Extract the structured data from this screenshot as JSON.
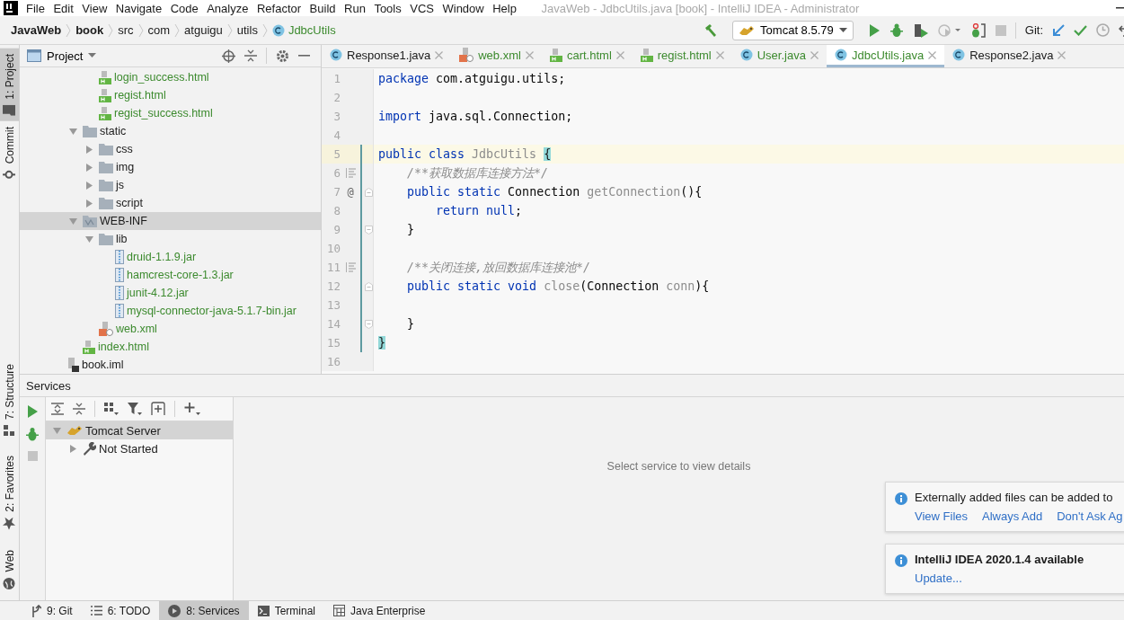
{
  "menu": {
    "items": [
      "File",
      "Edit",
      "View",
      "Navigate",
      "Code",
      "Analyze",
      "Refactor",
      "Build",
      "Run",
      "Tools",
      "VCS",
      "Window",
      "Help"
    ]
  },
  "title": "JavaWeb - JdbcUtils.java [book] - IntelliJ IDEA - Administrator",
  "breadcrumbs": [
    {
      "label": "JavaWeb",
      "kind": "module"
    },
    {
      "label": "book",
      "kind": "module"
    },
    {
      "label": "src",
      "kind": "dir"
    },
    {
      "label": "com",
      "kind": "dir"
    },
    {
      "label": "atguigu",
      "kind": "dir"
    },
    {
      "label": "utils",
      "kind": "dir"
    },
    {
      "label": "JdbcUtils",
      "kind": "class"
    }
  ],
  "toolbar": {
    "run_config": "Tomcat 8.5.79",
    "git_label": "Git:"
  },
  "left_stripe": {
    "top": [
      {
        "label": "1: Project",
        "kind": "folder",
        "selected": true
      },
      {
        "label": "Commit",
        "kind": "commit",
        "selected": false
      }
    ],
    "bottom": [
      {
        "label": "7: Structure",
        "kind": "structure",
        "selected": false
      },
      {
        "label": "2: Favorites",
        "kind": "star",
        "selected": false
      },
      {
        "label": "Web",
        "kind": "globe",
        "selected": false
      }
    ]
  },
  "project": {
    "title": "Project",
    "tree": [
      {
        "children": [
          {
            "children": [
              {
                "children": [
                  {
                    "label": "login_success.html",
                    "kind": "html",
                    "git_added": true,
                    "selected": false
                  },
                  {
                    "label": "regist.html",
                    "kind": "html",
                    "git_added": true,
                    "selected": false
                  },
                  {
                    "label": "regist_success.html",
                    "kind": "html",
                    "git_added": true,
                    "selected": false
                  }
                ]
              },
              {
                "label": "static",
                "kind": "folder",
                "git_added": false,
                "selected": false,
                "expanded": true,
                "children": [
                  {
                    "label": "css",
                    "kind": "folder",
                    "git_added": false,
                    "selected": false,
                    "expanded": false
                  },
                  {
                    "label": "img",
                    "kind": "folder",
                    "git_added": false,
                    "selected": false,
                    "expanded": false
                  },
                  {
                    "label": "js",
                    "kind": "folder",
                    "git_added": false,
                    "selected": false,
                    "expanded": false
                  },
                  {
                    "label": "script",
                    "kind": "folder",
                    "git_added": false,
                    "selected": false,
                    "expanded": false
                  }
                ]
              },
              {
                "label": "WEB-INF",
                "kind": "webinf",
                "git_added": false,
                "selected": true,
                "expanded": true,
                "children": [
                  {
                    "label": "lib",
                    "kind": "folder",
                    "git_added": false,
                    "selected": false,
                    "expanded": true,
                    "children": [
                      {
                        "label": "druid-1.1.9.jar",
                        "kind": "jar",
                        "git_added": true,
                        "selected": false
                      },
                      {
                        "label": "hamcrest-core-1.3.jar",
                        "kind": "jar",
                        "git_added": true,
                        "selected": false
                      },
                      {
                        "label": "junit-4.12.jar",
                        "kind": "jar",
                        "git_added": true,
                        "selected": false
                      },
                      {
                        "label": "mysql-connector-java-5.1.7-bin.jar",
                        "kind": "jar",
                        "git_added": true,
                        "selected": false
                      }
                    ]
                  },
                  {
                    "label": "web.xml",
                    "kind": "xml",
                    "git_added": true,
                    "selected": false
                  }
                ]
              },
              {
                "label": "index.html",
                "kind": "html",
                "git_added": true,
                "selected": false
              }
            ]
          },
          {
            "label": "book.iml",
            "kind": "iml",
            "git_added": false,
            "selected": false
          }
        ]
      }
    ]
  },
  "editor": {
    "tabs": [
      {
        "label": "Response1.java",
        "kind": "class",
        "git_added": false,
        "selected": false
      },
      {
        "label": "web.xml",
        "kind": "xml",
        "git_added": true,
        "selected": false
      },
      {
        "label": "cart.html",
        "kind": "html",
        "git_added": true,
        "selected": false
      },
      {
        "label": "regist.html",
        "kind": "html",
        "git_added": true,
        "selected": false
      },
      {
        "label": "User.java",
        "kind": "class",
        "git_added": true,
        "selected": false
      },
      {
        "label": "JdbcUtils.java",
        "kind": "class",
        "git_added": true,
        "selected": true
      },
      {
        "label": "Response2.java",
        "kind": "class",
        "git_added": false,
        "selected": false
      }
    ],
    "lines": [
      {
        "number": "1",
        "current": false,
        "added": false,
        "tokens": [
          {
            "text": "package ",
            "kind": "keyword"
          },
          {
            "text": "com.atguigu.utils;",
            "kind": "plain"
          }
        ]
      },
      {
        "number": "2",
        "current": false,
        "added": false
      },
      {
        "number": "3",
        "current": false,
        "added": false,
        "tokens": [
          {
            "text": "import ",
            "kind": "keyword"
          },
          {
            "text": "java.sql.Connection;",
            "kind": "plain"
          }
        ]
      },
      {
        "number": "4",
        "current": false,
        "added": false
      },
      {
        "number": "5",
        "current": true,
        "added": true,
        "tokens": [
          {
            "text": "public class ",
            "kind": "keyword"
          },
          {
            "text": "JdbcUtils ",
            "kind": "unused"
          },
          {
            "text": "{",
            "kind": "brace"
          }
        ]
      },
      {
        "number": "6",
        "current": false,
        "added": true,
        "marker": {
          "kind": "doc"
        },
        "tokens": [
          {
            "text": "    /**获取数据库连接方法*/",
            "kind": "comment"
          }
        ]
      },
      {
        "number": "7",
        "current": false,
        "added": true,
        "fold": {
          "kind": "start"
        },
        "gutter_text": "@",
        "tokens": [
          {
            "text": "    public static ",
            "kind": "keyword"
          },
          {
            "text": "Connection ",
            "kind": "plain"
          },
          {
            "text": "getConnection",
            "kind": "unused"
          },
          {
            "text": "(){",
            "kind": "plain"
          }
        ]
      },
      {
        "number": "8",
        "current": false,
        "added": true,
        "tokens": [
          {
            "text": "        return null",
            "kind": "keyword"
          },
          {
            "text": ";",
            "kind": "plain"
          }
        ]
      },
      {
        "number": "9",
        "current": false,
        "added": true,
        "fold": {
          "kind": "end"
        },
        "tokens": [
          {
            "text": "    }",
            "kind": "plain"
          }
        ]
      },
      {
        "number": "10",
        "current": false,
        "added": true
      },
      {
        "number": "11",
        "current": false,
        "added": true,
        "marker": {
          "kind": "doc"
        },
        "tokens": [
          {
            "text": "    /**关闭连接,放回数据库连接池*/",
            "kind": "comment"
          }
        ]
      },
      {
        "number": "12",
        "current": false,
        "added": true,
        "fold": {
          "kind": "start"
        },
        "tokens": [
          {
            "text": "    public static void ",
            "kind": "keyword"
          },
          {
            "text": "close",
            "kind": "unused"
          },
          {
            "text": "(Connection ",
            "kind": "plain"
          },
          {
            "text": "conn",
            "kind": "unused"
          },
          {
            "text": "){",
            "kind": "plain"
          }
        ]
      },
      {
        "number": "13",
        "current": false,
        "added": true
      },
      {
        "number": "14",
        "current": false,
        "added": true,
        "fold": {
          "kind": "end"
        },
        "tokens": [
          {
            "text": "    }",
            "kind": "plain"
          }
        ]
      },
      {
        "number": "15",
        "current": false,
        "added": true,
        "tokens": [
          {
            "text": "}",
            "kind": "brace"
          }
        ]
      },
      {
        "number": "16",
        "current": false,
        "added": false
      }
    ]
  },
  "services": {
    "title": "Services",
    "tree": [
      {
        "label": "Tomcat Server",
        "kind": "tomcat",
        "selected": true,
        "expanded": true,
        "children": [
          {
            "label": "Not Started",
            "kind": "wrench",
            "selected": false,
            "expanded": false
          }
        ]
      }
    ],
    "empty_text": "Select service to view details"
  },
  "notifications": [
    {
      "message": "Externally added files can be added to",
      "links": [
        "View Files",
        "Always Add",
        "Don't Ask Ag"
      ]
    },
    {
      "title": "IntelliJ IDEA 2020.1.4 available",
      "links": [
        "Update..."
      ]
    }
  ],
  "bottom_tabs": [
    {
      "label": "9: Git",
      "kind": "git",
      "selected": false
    },
    {
      "label": "6: TODO",
      "kind": "list",
      "selected": false
    },
    {
      "label": "8: Services",
      "kind": "play",
      "selected": true
    },
    {
      "label": "Terminal",
      "kind": "terminal",
      "selected": false
    },
    {
      "label": "Java Enterprise",
      "kind": "table",
      "selected": false
    }
  ]
}
